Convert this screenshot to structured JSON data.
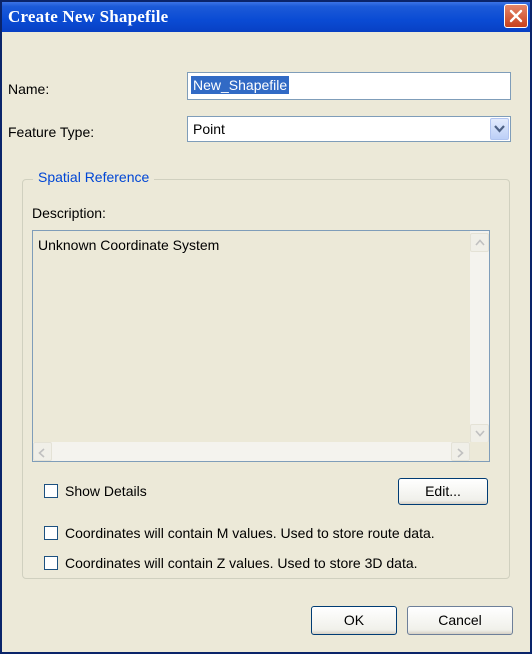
{
  "window": {
    "title": "Create New Shapefile",
    "close_icon": "close-icon"
  },
  "name": {
    "label": "Name:",
    "value": "New_Shapefile"
  },
  "feature_type": {
    "label": "Feature Type:",
    "value": "Point"
  },
  "spatial_reference": {
    "group_title": "Spatial Reference",
    "description_label": "Description:",
    "description_text": "Unknown Coordinate System"
  },
  "show_details": {
    "label": "Show Details",
    "checked": false
  },
  "edit_button": "Edit...",
  "m_values": {
    "label": "Coordinates will contain M values. Used to store route data.",
    "checked": false
  },
  "z_values": {
    "label": "Coordinates will contain Z values. Used to store 3D data.",
    "checked": false
  },
  "ok_button": "OK",
  "cancel_button": "Cancel",
  "colors": {
    "title_bar": "#0a4bd4",
    "dialog_bg": "#ece9d8",
    "group_title": "#0046d5",
    "selection": "#316ac5"
  }
}
